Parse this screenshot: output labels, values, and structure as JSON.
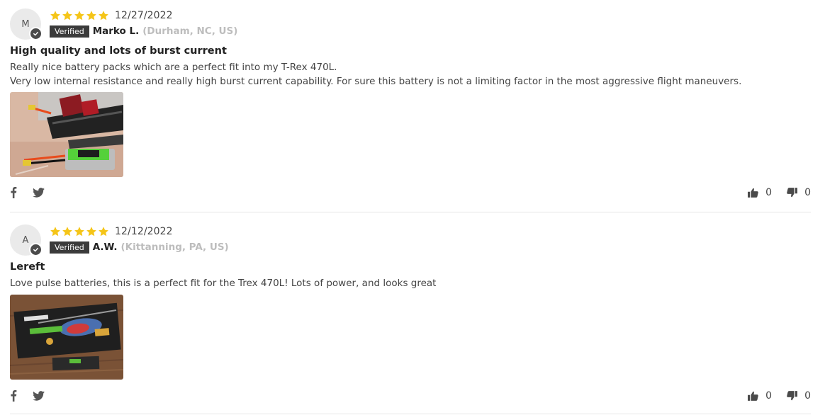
{
  "reviews": [
    {
      "avatar_initial": "M",
      "rating": 5,
      "date": "12/27/2022",
      "verified_label": "Verified",
      "author": "Marko L.",
      "location": "(Durham, NC, US)",
      "title": "High quality and lots of burst current",
      "body_lines": [
        "Really nice battery packs which are a perfect fit into my T-Rex 470L.",
        "Very low internal resistance and really high burst current capability. For sure this battery is not a limiting factor in the most aggressive flight maneuvers."
      ],
      "upvotes": "0",
      "downvotes": "0"
    },
    {
      "avatar_initial": "A",
      "rating": 5,
      "date": "12/12/2022",
      "verified_label": "Verified",
      "author": "A.W.",
      "location": "(Kittanning, PA, US)",
      "title": "Lereft",
      "body_lines": [
        "Love pulse batteries, this is a perfect fit for the Trex 470L! Lots of power, and looks great"
      ],
      "upvotes": "0",
      "downvotes": "0"
    }
  ],
  "colors": {
    "star": "#f5c518",
    "verified_bg": "#3b3b3b",
    "text": "#444444",
    "location": "#bdbdbd",
    "divider": "#e6e6e6"
  },
  "icons": [
    "star-icon",
    "verified-check-icon",
    "facebook-icon",
    "twitter-icon",
    "thumbs-up-icon",
    "thumbs-down-icon"
  ]
}
